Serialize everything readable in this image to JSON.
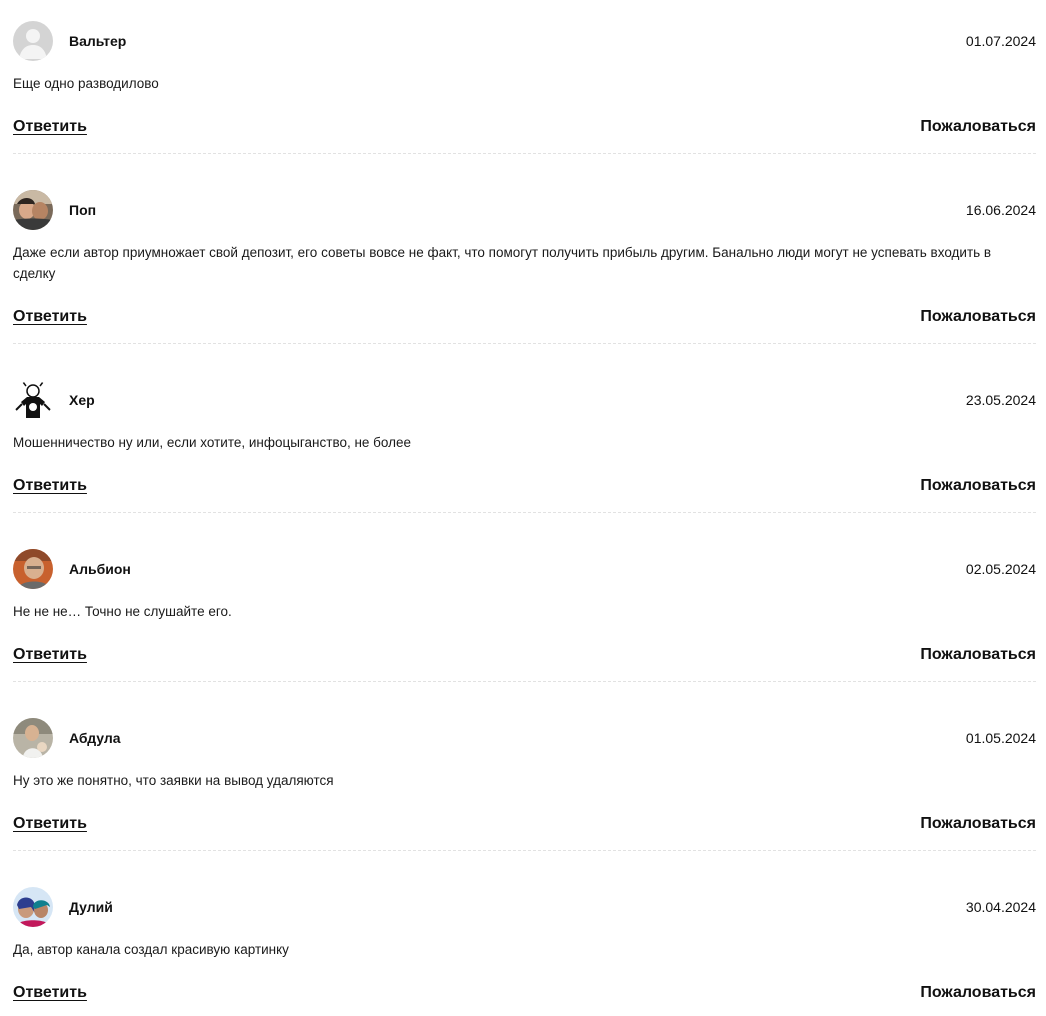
{
  "comments": [
    {
      "author": "Вальтер",
      "date": "01.07.2024",
      "text": "Еще одно разводилово",
      "reply_label": "Ответить",
      "report_label": "Пожаловаться",
      "avatar_icon": "default-user-icon"
    },
    {
      "author": "Поп",
      "date": "16.06.2024",
      "text": "Даже если автор приумножает свой депозит, его советы вовсе не факт, что помогут получить прибыль другим. Банально люди могут не успевать входить в сделку",
      "reply_label": "Ответить",
      "report_label": "Пожаловаться",
      "avatar_icon": "user-photo-avatar"
    },
    {
      "author": "Хер",
      "date": "23.05.2024",
      "text": "Мошенничество ну или, если хотите, инфоцыганство, не более",
      "reply_label": "Ответить",
      "report_label": "Пожаловаться",
      "avatar_icon": "user-photo-avatar"
    },
    {
      "author": "Альбион",
      "date": "02.05.2024",
      "text": "Не не не… Точно не слушайте его.",
      "reply_label": "Ответить",
      "report_label": "Пожаловаться",
      "avatar_icon": "user-photo-avatar"
    },
    {
      "author": "Абдула",
      "date": "01.05.2024",
      "text": "Ну это же понятно, что заявки на вывод удаляются",
      "reply_label": "Ответить",
      "report_label": "Пожаловаться",
      "avatar_icon": "user-photo-avatar"
    },
    {
      "author": "Дулий",
      "date": "30.04.2024",
      "text": "Да, автор канала создал красивую картинку",
      "reply_label": "Ответить",
      "report_label": "Пожаловаться",
      "avatar_icon": "user-photo-avatar"
    }
  ]
}
